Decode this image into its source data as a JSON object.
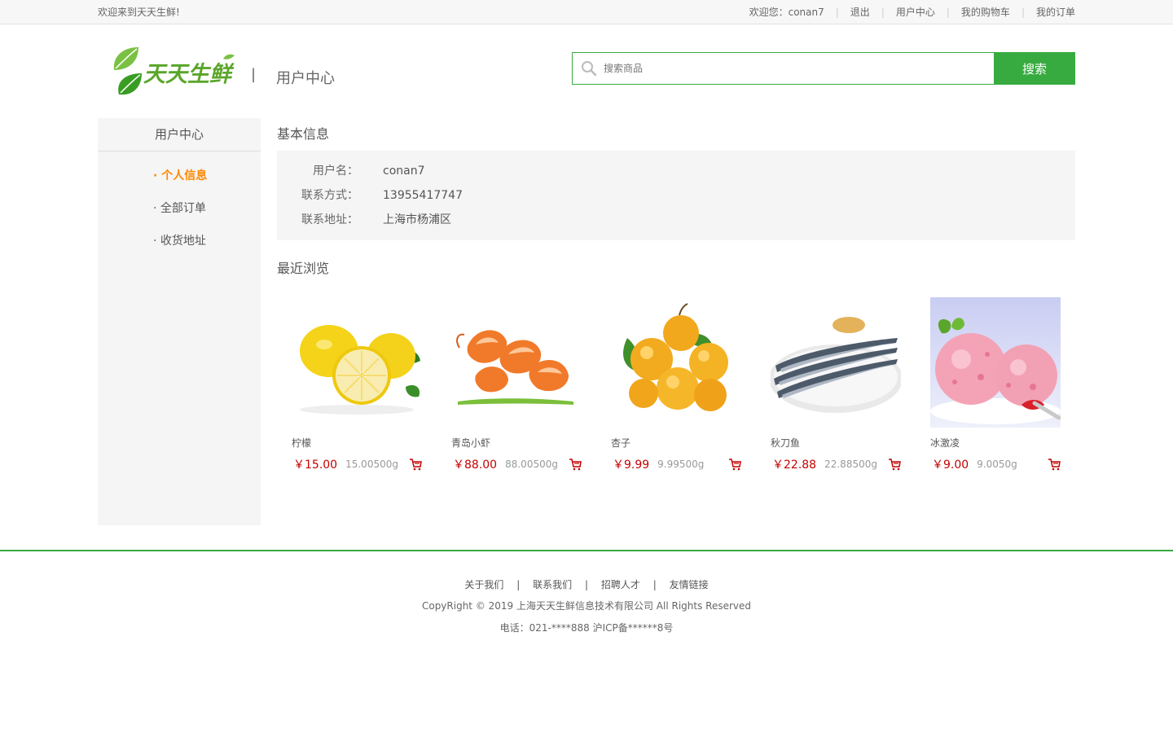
{
  "topbar": {
    "welcome": "欢迎来到天天生鲜!",
    "greeting": "欢迎您：conan7",
    "logout": "退出",
    "user_center": "用户中心",
    "cart": "我的购物车",
    "orders": "我的订单",
    "separator": "|"
  },
  "header": {
    "logo_text": "天天生鲜",
    "divider": "|",
    "title": "用户中心",
    "search_placeholder": "搜索商品",
    "search_button": "搜索"
  },
  "sidebar": {
    "title": "用户中心",
    "items": [
      {
        "label": "· 个人信息",
        "active": true
      },
      {
        "label": "· 全部订单",
        "active": false
      },
      {
        "label": "· 收货地址",
        "active": false
      }
    ]
  },
  "basic_info": {
    "title": "基本信息",
    "rows": [
      {
        "key": "用户名：",
        "value": "conan7"
      },
      {
        "key": "联系方式：",
        "value": "13955417747"
      },
      {
        "key": "联系地址：",
        "value": "上海市杨浦区"
      }
    ]
  },
  "recent": {
    "title": "最近浏览",
    "goods": [
      {
        "name": "柠檬",
        "price": "￥15.00",
        "unit": "15.00500g",
        "image": "lemon"
      },
      {
        "name": "青岛小虾",
        "price": "￥88.00",
        "unit": "88.00500g",
        "image": "shrimp"
      },
      {
        "name": "杏子",
        "price": "￥9.99",
        "unit": "9.99500g",
        "image": "apricot"
      },
      {
        "name": "秋刀鱼",
        "price": "￥22.88",
        "unit": "22.88500g",
        "image": "saury"
      },
      {
        "name": "冰激凌",
        "price": "￥9.00",
        "unit": "9.0050g",
        "image": "icecream"
      }
    ]
  },
  "footer": {
    "links": [
      "关于我们",
      "联系我们",
      "招聘人才",
      "友情链接"
    ],
    "separator": "|",
    "copyright": "CopyRight © 2019 上海天天生鲜信息技术有限公司 All Rights Reserved",
    "tel": "电话：021-****888 沪ICP备******8号"
  },
  "colors": {
    "brand_green": "#37ab40",
    "active_orange": "#ff8800",
    "price_red": "#c40000"
  },
  "icons": {
    "search": "search-icon",
    "cart": "add-to-cart-icon",
    "logo": "leaf-logo-icon"
  }
}
